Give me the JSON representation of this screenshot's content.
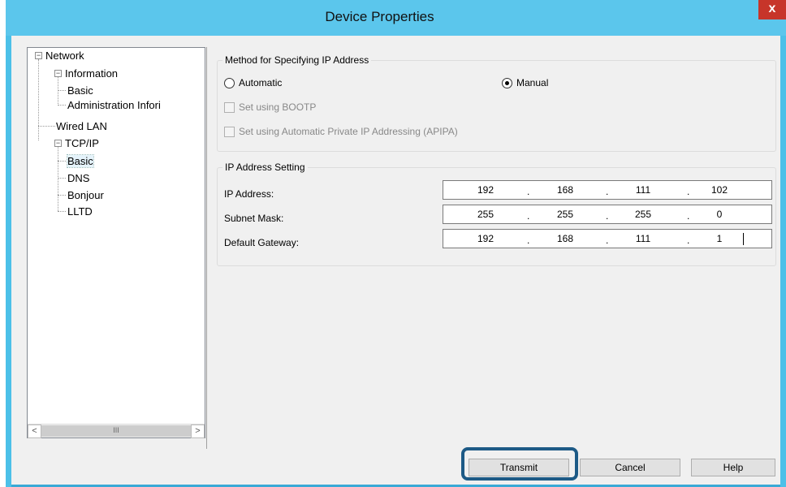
{
  "window": {
    "title": "Device Properties",
    "close_label": "x"
  },
  "tree": {
    "items": [
      {
        "label": "Network"
      },
      {
        "label": "Information"
      },
      {
        "label": "Basic"
      },
      {
        "label": "Administration Infori"
      },
      {
        "label": "Wired LAN"
      },
      {
        "label": "TCP/IP"
      },
      {
        "label": "Basic"
      },
      {
        "label": "DNS"
      },
      {
        "label": "Bonjour"
      },
      {
        "label": "LLTD"
      }
    ],
    "selected_index": 6,
    "scroll_left": "<",
    "scroll_right": ">",
    "scroll_thumb": "III"
  },
  "method": {
    "title": "Method for Specifying IP Address",
    "automatic_label": "Automatic",
    "manual_label": "Manual",
    "selected": "Manual",
    "bootp_label": "Set using BOOTP",
    "apipa_label": "Set using Automatic Private IP Addressing (APIPA)"
  },
  "ip_setting": {
    "title": "IP Address Setting",
    "fields": [
      {
        "label": "IP Address:",
        "octets": [
          "192",
          "168",
          "111",
          "102"
        ]
      },
      {
        "label": "Subnet Mask:",
        "octets": [
          "255",
          "255",
          "255",
          "0"
        ]
      },
      {
        "label": "Default Gateway:",
        "octets": [
          "192",
          "168",
          "111",
          "1"
        ]
      }
    ],
    "separator": "."
  },
  "buttons": {
    "transmit": "Transmit",
    "cancel": "Cancel",
    "help": "Help"
  },
  "colors": {
    "titlebar": "#5bc6ec",
    "close": "#c7352a",
    "highlight": "#1d5a86"
  }
}
